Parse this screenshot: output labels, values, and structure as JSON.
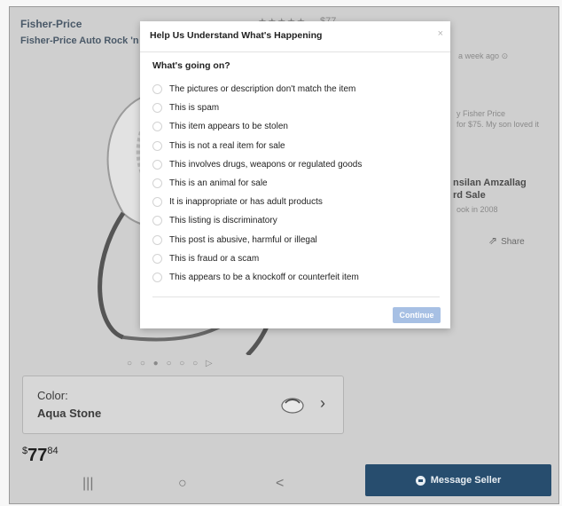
{
  "product": {
    "brand": "Fisher-Price",
    "title": "Fisher-Price Auto Rock 'n",
    "rating_stars": "★★★★★",
    "price_top": "$77",
    "color_label": "Color:",
    "color_value": "Aqua Stone",
    "price": {
      "currency": "$",
      "whole": "77",
      "fraction": "84"
    },
    "carousel_dots": "○ ○ ● ○ ○ ○ ▷"
  },
  "sidebar": {
    "posted": "a week ago",
    "desc_line1": "y Fisher Price",
    "desc_line2": "for $75. My son loved it",
    "seller_line1": "nsilan Amzallag",
    "seller_line2": "rd Sale",
    "seller_since": "ook in 2008",
    "share_label": "Share"
  },
  "modal": {
    "title": "Help Us Understand What's Happening",
    "close_glyph": "×",
    "question": "What's going on?",
    "options": [
      "The pictures or description don't match the item",
      "This is spam",
      "This item appears to be stolen",
      "This is not a real item for sale",
      "This involves drugs, weapons or regulated goods",
      "This is an animal for sale",
      "It is inappropriate or has adult products",
      "This listing is discriminatory",
      "This post is abusive, harmful or illegal",
      "This is fraud or a scam",
      "This appears to be a knockoff or counterfeit item"
    ],
    "continue_label": "Continue"
  },
  "bottom": {
    "message_seller_label": "Message Seller",
    "nav_recent": "|||",
    "nav_home": "○",
    "nav_back": "<"
  },
  "colors": {
    "accent": "#274d6e",
    "continue_disabled": "#a7c0e4"
  }
}
